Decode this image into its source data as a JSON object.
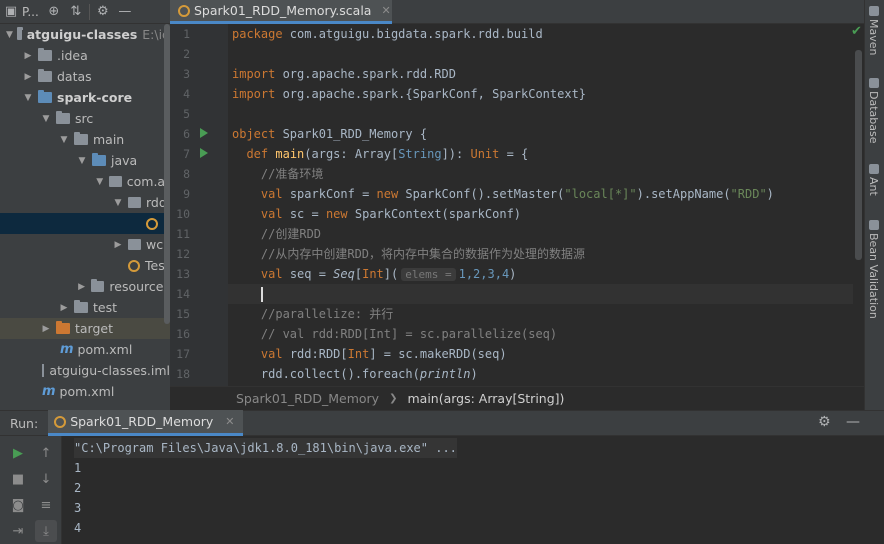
{
  "project_panel": {
    "title": "P...",
    "tree": [
      {
        "label": "atguigu-classes",
        "extra": "E:\\id",
        "bold": true
      },
      {
        "label": ".idea"
      },
      {
        "label": "datas"
      },
      {
        "label": "spark-core",
        "bold": true
      },
      {
        "label": "src"
      },
      {
        "label": "main"
      },
      {
        "label": "java"
      },
      {
        "label": "com.at"
      },
      {
        "label": "rdd"
      },
      {
        "label": ""
      },
      {
        "label": "wc"
      },
      {
        "label": "Tes"
      },
      {
        "label": "resources"
      },
      {
        "label": "test"
      },
      {
        "label": "target"
      },
      {
        "label": "pom.xml"
      },
      {
        "label": "atguigu-classes.iml"
      },
      {
        "label": "pom.xml"
      }
    ]
  },
  "editor": {
    "tab_label": "Spark01_RDD_Memory.scala",
    "line_numbers": [
      "1",
      "2",
      "3",
      "4",
      "5",
      "6",
      "7",
      "8",
      "9",
      "10",
      "11",
      "12",
      "13",
      "14",
      "15",
      "16",
      "17",
      "18"
    ],
    "code": {
      "l1_kw": "package",
      "l1_rest": " com.atguigu.bigdata.spark.rdd.build",
      "l3_kw": "import",
      "l3_rest": " org.apache.spark.rdd.RDD",
      "l4_kw": "import",
      "l4_rest": " org.apache.spark.{SparkConf, SparkContext}",
      "l6_kw": "object",
      "l6_rest": " Spark01_RDD_Memory {",
      "l7_kw": "def",
      "l7_fn": "main",
      "l7_a": "(args: Array[",
      "l7_ty": "String",
      "l7_b": "]): ",
      "l7_unit": "Unit",
      "l7_c": " = {",
      "l8": "//准备环境",
      "l9_kw": "val",
      "l9_a": " sparkConf = ",
      "l9_new": "new",
      "l9_b": " SparkConf().setMaster(",
      "l9_s1": "\"local[*]\"",
      "l9_c": ").setAppName(",
      "l9_s2": "\"RDD\"",
      "l9_d": ")",
      "l10_kw": "val",
      "l10_a": " sc = ",
      "l10_new": "new",
      "l10_b": " SparkContext(sparkConf)",
      "l11": "//创建RDD",
      "l12": "//从内存中创建RDD，将内存中集合的数据作为处理的数据源",
      "l13_kw": "val",
      "l13_a": " seq = ",
      "l13_seq": "Seq",
      "l13_b": "[",
      "l13_int": "Int",
      "l13_c": "](",
      "l13_hint": "elems =",
      "l13_nums": "1,2,3,4",
      "l13_d": ")",
      "l15": "//parallelize: 并行",
      "l16": "// val rdd:RDD[Int] = sc.parallelize(seq)",
      "l17_kw": "val",
      "l17_a": " rdd:RDD[",
      "l17_int": "Int",
      "l17_b": "] = sc.makeRDD(seq)",
      "l18_a": "rdd.collect().foreach(",
      "l18_fn": "println",
      "l18_b": ")"
    }
  },
  "breadcrumb": {
    "item1": "Spark01_RDD_Memory",
    "item2": "main(args: Array[String])"
  },
  "right_stripe": [
    "Maven",
    "Database",
    "Ant",
    "Bean Validation"
  ],
  "run_panel": {
    "run_label": "Run:",
    "tab_label": "Spark01_RDD_Memory",
    "console": [
      "\"C:\\Program Files\\Java\\jdk1.8.0_181\\bin\\java.exe\" ...",
      "1",
      "2",
      "3",
      "4"
    ]
  },
  "colors": {
    "keyword": "#cc7832",
    "function": "#ffc66d",
    "string": "#6a8759",
    "number": "#6897bb",
    "comment": "#808080",
    "accent": "#4a88c7",
    "run_green": "#499c54"
  }
}
